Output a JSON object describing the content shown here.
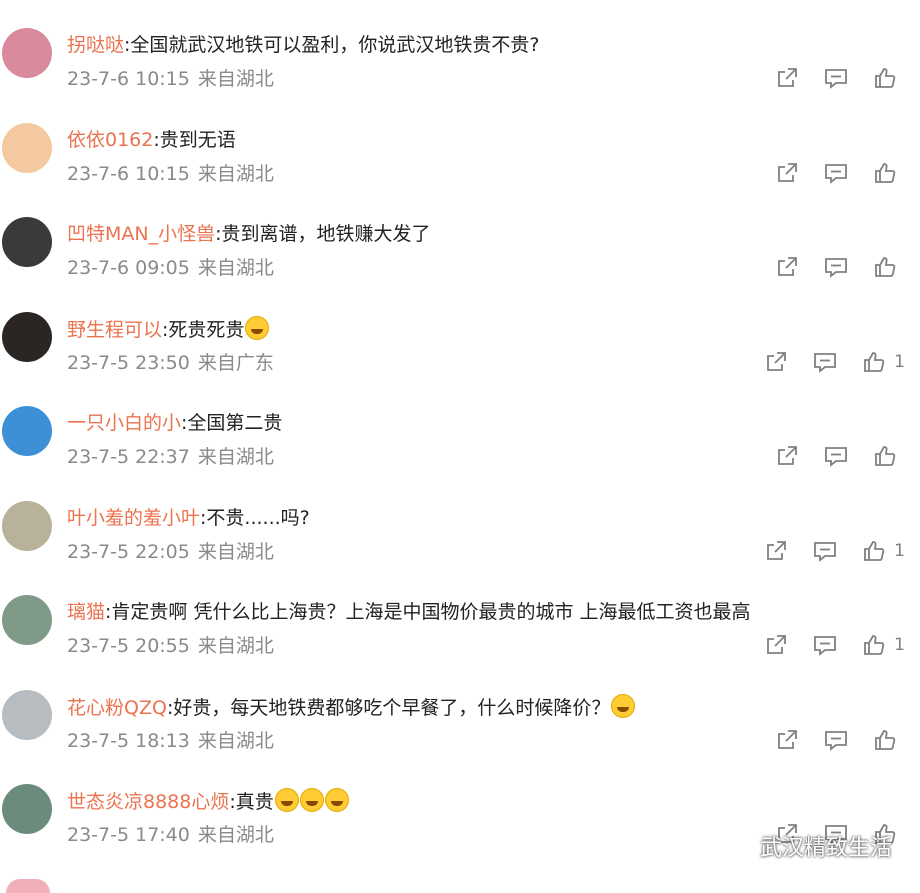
{
  "comments": [
    {
      "user": "拐哒哒",
      "text": "全国就武汉地铁可以盈利，你说武汉地铁贵不贵?",
      "date": "23-7-6 10:15",
      "loc": "来自湖北",
      "likes": "",
      "avatar_color": "#d98a9c",
      "emojis": 0
    },
    {
      "user": "依依0162",
      "text": "贵到无语",
      "date": "23-7-6 10:15",
      "loc": "来自湖北",
      "likes": "",
      "avatar_color": "#f5c9a0",
      "emojis": 0
    },
    {
      "user": "凹特MAN_小怪兽",
      "text": "贵到离谱，地铁赚大发了",
      "date": "23-7-6 09:05",
      "loc": "来自湖北",
      "likes": "",
      "avatar_color": "#3a3a3a",
      "emojis": 0
    },
    {
      "user": "野生程可以",
      "text": "死贵死贵",
      "date": "23-7-5 23:50",
      "loc": "来自广东",
      "likes": "1",
      "avatar_color": "#2b2623",
      "emojis": 1
    },
    {
      "user": "一只小白的小",
      "text": "全国第二贵",
      "date": "23-7-5 22:37",
      "loc": "来自湖北",
      "likes": "",
      "avatar_color": "#3d8fd6",
      "emojis": 0
    },
    {
      "user": "叶小羞的羞小叶",
      "text": "不贵......吗?",
      "date": "23-7-5 22:05",
      "loc": "来自湖北",
      "likes": "1",
      "avatar_color": "#b8b29a",
      "emojis": 0
    },
    {
      "user": "璃猫",
      "text": "肯定贵啊 凭什么比上海贵？上海是中国物价最贵的城市 上海最低工资也最高",
      "date": "23-7-5 20:55",
      "loc": "来自湖北",
      "likes": "1",
      "avatar_color": "#7f9a86",
      "emojis": 0
    },
    {
      "user": "花心粉QZQ",
      "text": "好贵，每天地铁费都够吃个早餐了，什么时候降价？",
      "date": "23-7-5 18:13",
      "loc": "来自湖北",
      "likes": "",
      "avatar_color": "#b7bcc0",
      "emojis": 1
    },
    {
      "user": "世态炎凉8888心烦",
      "text": "真贵",
      "date": "23-7-5 17:40",
      "loc": "来自湖北",
      "likes": "",
      "avatar_color": "#6b8c7c",
      "emojis": 3
    }
  ],
  "icons": {
    "share": "share-icon",
    "comment": "comment-icon",
    "like": "like-icon"
  },
  "colors": {
    "username": "#eb7350",
    "meta": "#8a8a8a",
    "icon": "#808080"
  },
  "watermark": {
    "text": "武汉精致生活",
    "icon": "wechat-icon"
  }
}
